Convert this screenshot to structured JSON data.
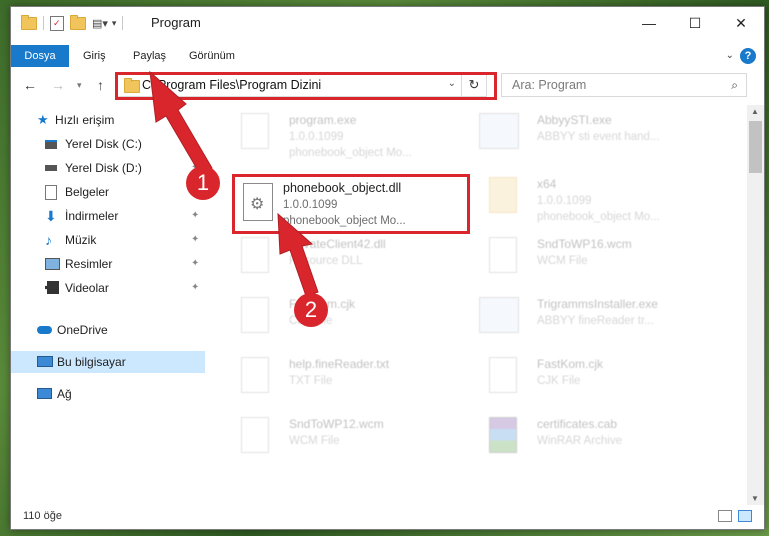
{
  "window": {
    "title": "Program",
    "controls": {
      "minimize": "—",
      "maximize": "☐",
      "close": "✕"
    }
  },
  "ribbon": {
    "tabs": [
      "Dosya",
      "Giriş",
      "Paylaş",
      "Görünüm"
    ],
    "help": "?"
  },
  "navigation": {
    "address": "C:\\Program Files\\Program Dizini",
    "search_placeholder": "Ara: Program"
  },
  "sidebar": {
    "items": [
      {
        "label": "Hızlı erişim",
        "icon": "star-icon"
      },
      {
        "label": "Yerel Disk (C:)",
        "icon": "drive-icon"
      },
      {
        "label": "Yerel Disk (D:)",
        "icon": "drive-icon"
      },
      {
        "label": "Belgeler",
        "icon": "documents-icon"
      },
      {
        "label": "İndirmeler",
        "icon": "download-icon"
      },
      {
        "label": "Müzik",
        "icon": "music-icon"
      },
      {
        "label": "Resimler",
        "icon": "pictures-icon"
      },
      {
        "label": "Videolar",
        "icon": "video-icon"
      },
      {
        "label": "OneDrive",
        "icon": "cloud-icon"
      },
      {
        "label": "Bu bilgisayar",
        "icon": "computer-icon"
      },
      {
        "label": "Ağ",
        "icon": "network-icon"
      }
    ]
  },
  "files": [
    {
      "name": "program.exe",
      "line2": "1.0.0.1099",
      "line3": "phonebook_object Mo..."
    },
    {
      "name": "AbbyySTI.exe",
      "line2": "ABBYY sti event hand...",
      "line3": ""
    },
    {
      "name": "phonebook_object.dll",
      "line2": "1.0.0.1099",
      "line3": "phonebook_object Mo..."
    },
    {
      "name": "x64",
      "line2": "1.0.0.1099",
      "line3": "phonebook_object Mo..."
    },
    {
      "name": "PrivateClient42.dll",
      "line2": "Resource DLL",
      "line3": ""
    },
    {
      "name": "SndToWP16.wcm",
      "line2": "WCM File",
      "line3": ""
    },
    {
      "name": "FastKom.cjk",
      "line2": "CJK File",
      "line3": ""
    },
    {
      "name": "TrigrammsInstaller.exe",
      "line2": "ABBYY fineReader tr...",
      "line3": ""
    },
    {
      "name": "help.fineReader.txt",
      "line2": "TXT File",
      "line3": ""
    },
    {
      "name": "FastKom.cjk",
      "line2": "CJK File",
      "line3": ""
    },
    {
      "name": "SndToWP12.wcm",
      "line2": "WCM File",
      "line3": ""
    },
    {
      "name": "certificates.cab",
      "line2": "WinRAR Archive",
      "line3": ""
    }
  ],
  "status": {
    "count": "110 öğe"
  },
  "markers": [
    "1",
    "2"
  ],
  "colors": {
    "accent": "#1979ca",
    "highlight": "#d9262c",
    "selection": "#cce8ff"
  }
}
